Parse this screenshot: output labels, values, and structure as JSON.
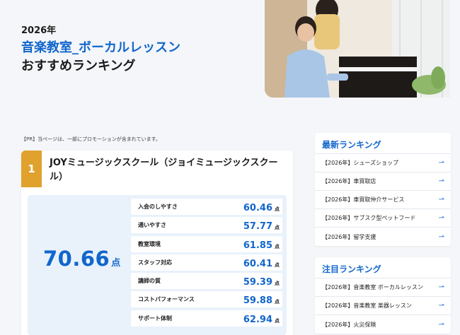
{
  "hero": {
    "year": "2026年",
    "title_main": "音楽教室_ボーカルレッスン",
    "title_sub": "おすすめランキング"
  },
  "pr_note": "【PR】当ページは、一部にプロモーションが含まれています。",
  "ranking": {
    "rank": "1",
    "name": "JOYミュージックスクール（ジョイミュージックスクール）",
    "total_score": "70.66",
    "total_unit": "点",
    "scores": [
      {
        "label": "入会のしやすさ",
        "value": "60.46",
        "unit": "点"
      },
      {
        "label": "通いやすさ",
        "value": "57.77",
        "unit": "点"
      },
      {
        "label": "教室環境",
        "value": "61.85",
        "unit": "点"
      },
      {
        "label": "スタッフ対応",
        "value": "60.41",
        "unit": "点"
      },
      {
        "label": "講師の質",
        "value": "59.39",
        "unit": "点"
      },
      {
        "label": "コストパフォーマンス",
        "value": "59.88",
        "unit": "点"
      },
      {
        "label": "サポート体制",
        "value": "62.94",
        "unit": "点"
      }
    ]
  },
  "sidebar": {
    "latest": {
      "title": "最新ランキング",
      "items": [
        {
          "label": "【2026年】シューズショップ"
        },
        {
          "label": "【2026年】車買取店"
        },
        {
          "label": "【2026年】車買取仲介サービス"
        },
        {
          "label": "【2026年】サブスク型ペットフード"
        },
        {
          "label": "【2026年】留学支援"
        }
      ]
    },
    "featured": {
      "title": "注目ランキング",
      "items": [
        {
          "label": "【2026年】音楽教室 ボーカルレッスン"
        },
        {
          "label": "【2026年】音楽教室 楽器レッスン"
        },
        {
          "label": "【2026年】火災保険"
        }
      ]
    },
    "arrow_icon": "arrow-right-icon"
  },
  "colors": {
    "accent": "#1166cc",
    "rank_gold": "#e0a22c",
    "panel_bg": "#e9f2fb"
  }
}
